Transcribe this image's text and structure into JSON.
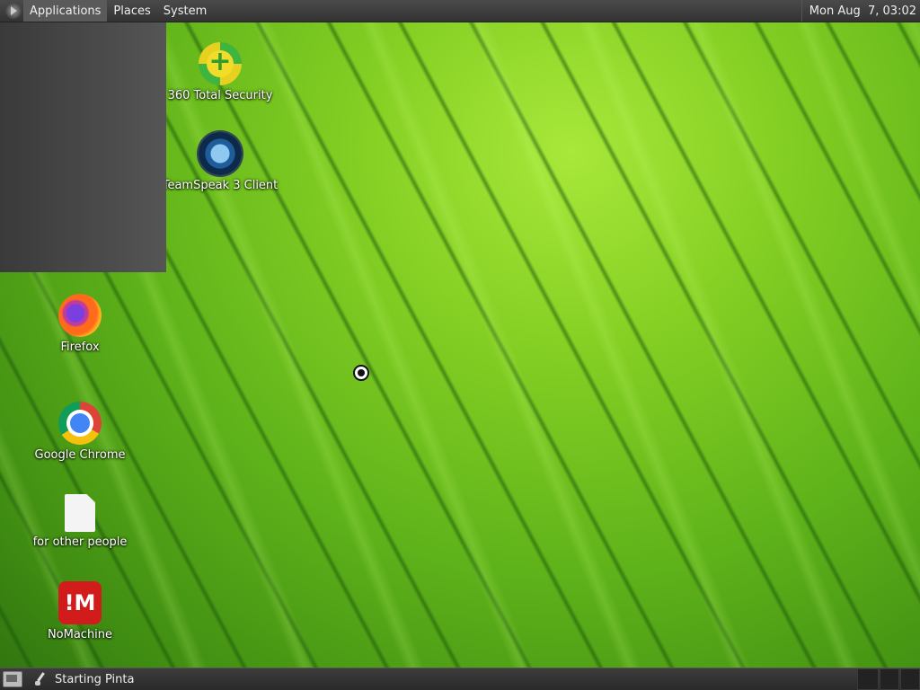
{
  "topbar": {
    "menus": [
      "Applications",
      "Places",
      "System"
    ],
    "clock": "Mon Aug  7, 03:02"
  },
  "desktop_icons": [
    {
      "label": "360 Total Security",
      "icon": "360-total-security-icon"
    },
    {
      "label": "TeamSpeak 3 Client",
      "icon": "teamspeak-icon"
    },
    {
      "label": "Firefox",
      "icon": "firefox-icon"
    },
    {
      "label": "Google Chrome",
      "icon": "chrome-icon"
    },
    {
      "label": "for other people",
      "icon": "document-icon"
    },
    {
      "label": "NoMachine",
      "icon": "nomachine-icon",
      "glyph": "!M"
    }
  ],
  "taskbar": {
    "task_label": "Starting Pinta"
  }
}
